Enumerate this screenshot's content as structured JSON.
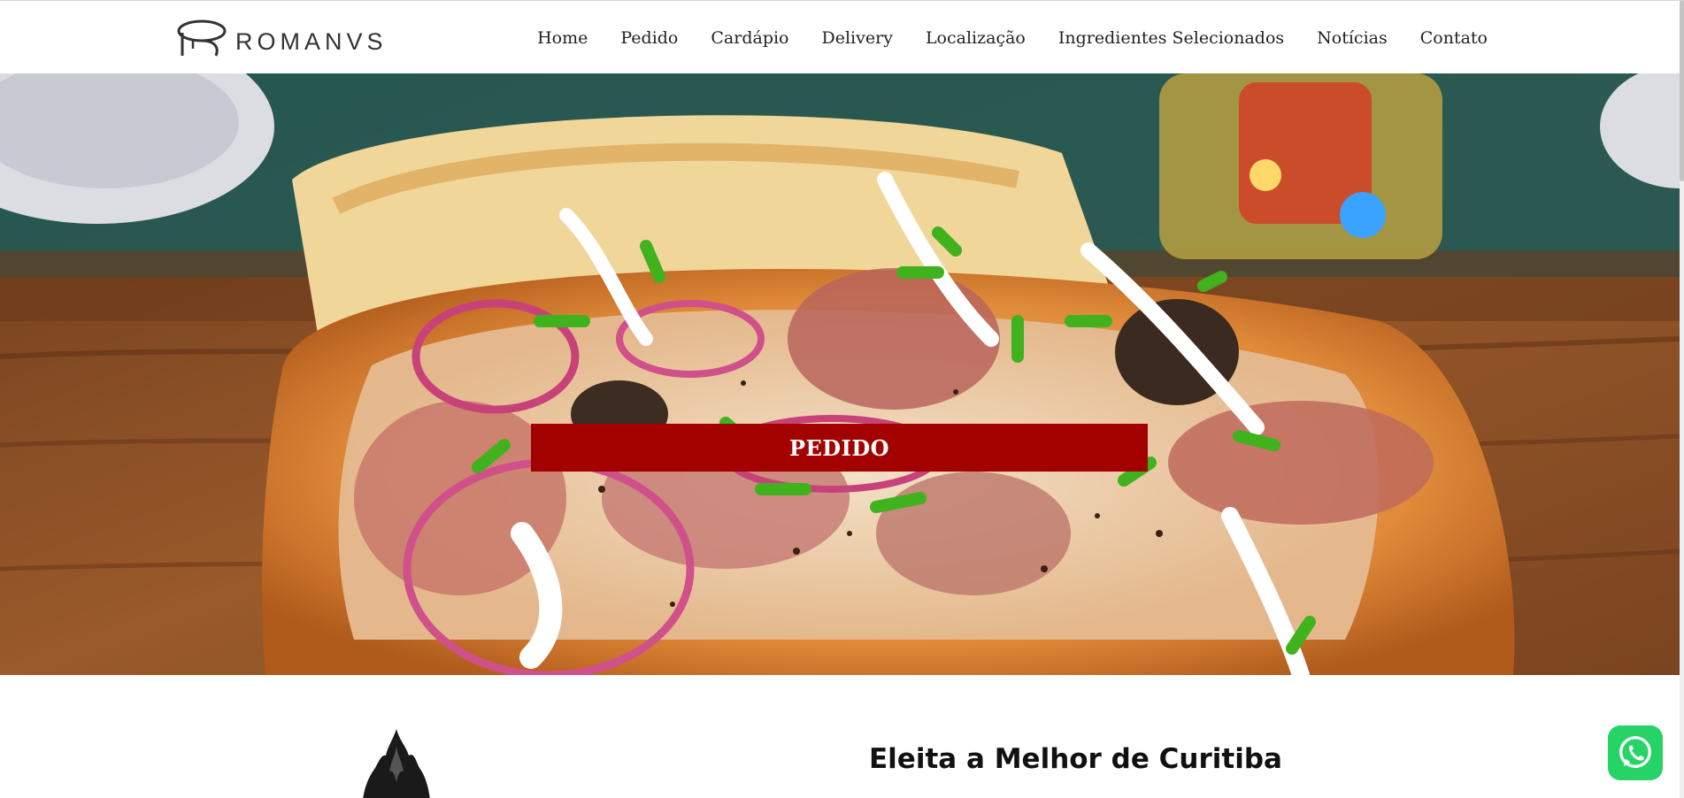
{
  "brand": {
    "name": "ROMANVS",
    "logo_icon": "romanvs-logo-icon"
  },
  "nav": {
    "items": [
      {
        "label": "Home"
      },
      {
        "label": "Pedido"
      },
      {
        "label": "Cardápio"
      },
      {
        "label": "Delivery"
      },
      {
        "label": "Localização"
      },
      {
        "label": "Ingredientes Selecionados"
      },
      {
        "label": "Notícias"
      },
      {
        "label": "Contato"
      }
    ]
  },
  "hero": {
    "image": "pizza-photo",
    "button_label": "PEDIDO",
    "button_color": "#a30000"
  },
  "section": {
    "title": "Eleita a Melhor de Curitiba",
    "icon": "flame-icon"
  },
  "whatsapp": {
    "icon": "whatsapp-icon",
    "color": "#25d366"
  }
}
